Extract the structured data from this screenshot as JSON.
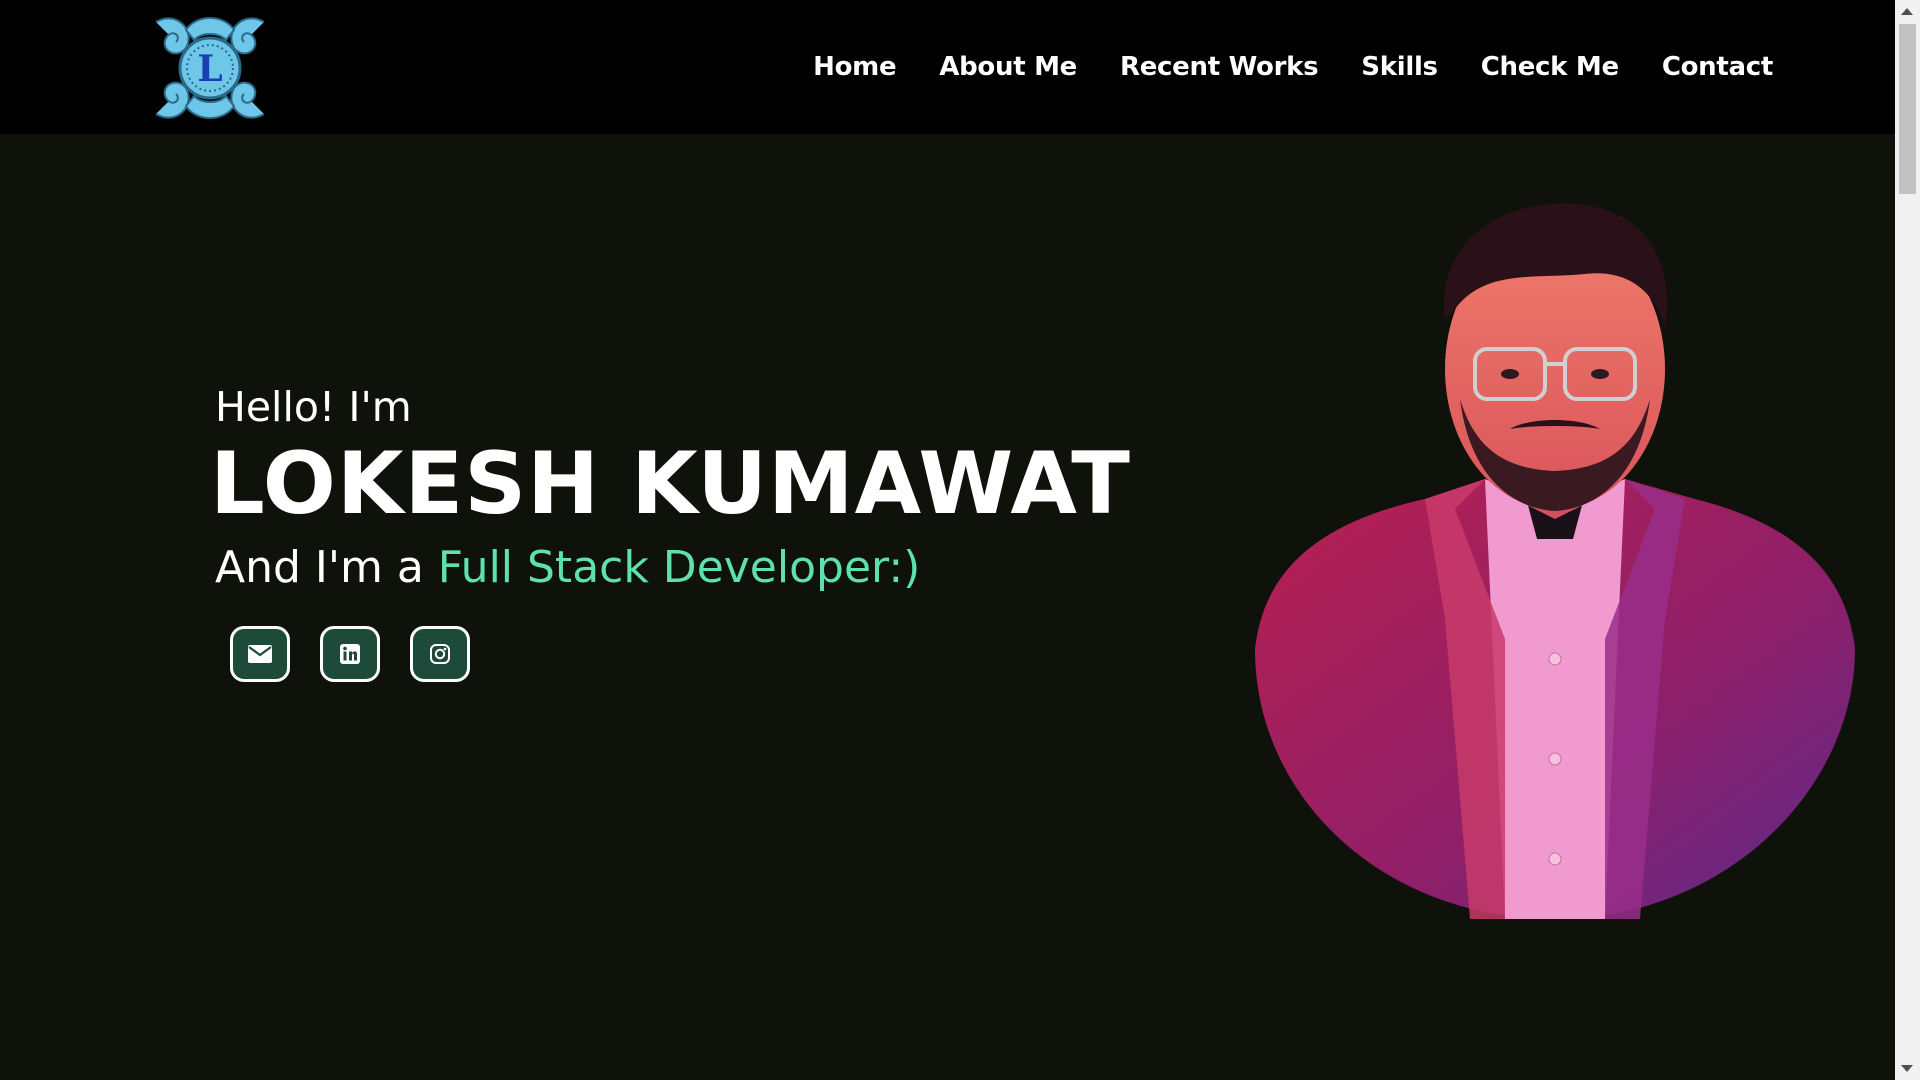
{
  "header": {
    "logo_letter": "L",
    "nav": [
      {
        "label": "Home"
      },
      {
        "label": "About Me"
      },
      {
        "label": "Recent Works"
      },
      {
        "label": "Skills"
      },
      {
        "label": "Check Me"
      },
      {
        "label": "Contact"
      }
    ]
  },
  "hero": {
    "greeting": "Hello! I'm",
    "name": "LOKESH KUMAWAT",
    "role_prefix": "And I'm a ",
    "role": "Full Stack Developer:)",
    "socials": [
      {
        "icon": "mail-icon"
      },
      {
        "icon": "linkedin-icon"
      },
      {
        "icon": "instagram-icon"
      }
    ]
  },
  "colors": {
    "header_bg": "#000000",
    "hero_bg": "#0f120b",
    "accent": "#5ee0b1",
    "social_bg": "#1e4a3a",
    "logo_blue": "#6ec6e8"
  }
}
